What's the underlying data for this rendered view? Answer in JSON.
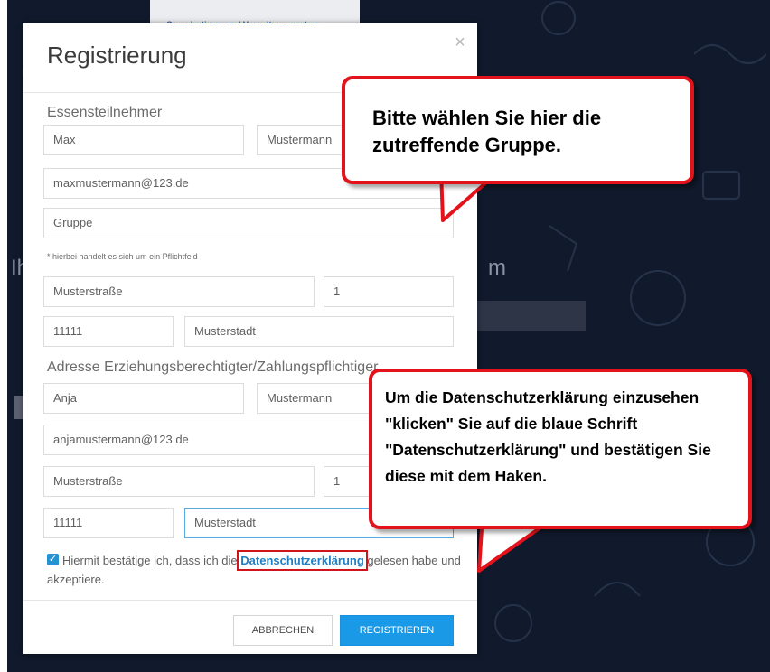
{
  "modal": {
    "title": "Registrierung",
    "close_icon": "×",
    "section_participant": "Essensteilnehmer",
    "participant": {
      "first_name": "Max",
      "last_name": "Mustermann",
      "email": "maxmustermann@123.de",
      "group": "Gruppe",
      "required_note": "* hierbei handelt es sich um ein Pflichtfeld",
      "street": "Musterstraße",
      "house_number": "1",
      "zip": "11111",
      "city": "Musterstadt"
    },
    "section_guardian": "Adresse Erziehungsberechtigter/Zahlungspflichtiger",
    "guardian": {
      "first_name": "Anja",
      "last_name": "Mustermann",
      "email": "anjamustermann@123.de",
      "street": "Musterstraße",
      "house_number": "1",
      "zip": "11111",
      "city": "Musterstadt"
    },
    "consent": {
      "checked": true,
      "before_link": "Hiermit bestätige ich, dass ich die ",
      "link": "Datenschutzerklärung",
      "after_link": " gelesen habe und akzeptiere."
    },
    "cancel_label": "ABBRECHEN",
    "register_label": "REGISTRIEREN"
  },
  "callouts": {
    "group_hint": "Bitte wählen Sie hier die zutreffende Gruppe.",
    "privacy_hint": "Um die Datenschutzerklärung einzusehen \"klicken\" Sie auf die blaue Schrift \"Datenschutzerklärung\" und bestätigen Sie diese mit dem Haken."
  },
  "background": {
    "logo_subtitle": "Organisations- und Verwaltungssystem",
    "heading_left": "Ih",
    "heading_right": "m"
  },
  "colors": {
    "background": "#101a2c",
    "primary_button": "#1a9ae6",
    "link": "#1e7fc4",
    "callout_border": "#e3131b"
  }
}
